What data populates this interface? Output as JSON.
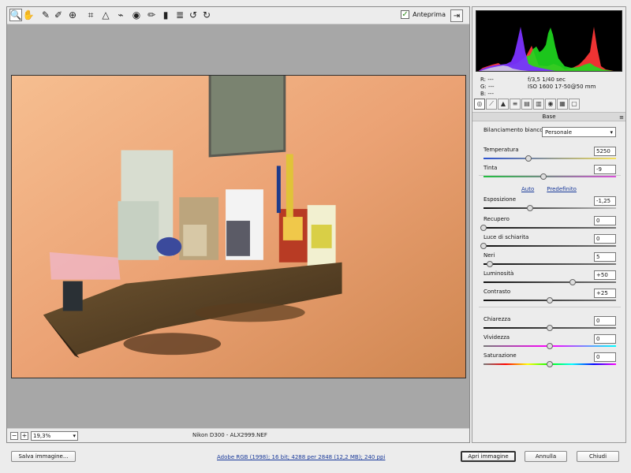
{
  "toolbar": {
    "tools": [
      {
        "name": "zoom-tool",
        "icon": "magnifier-icon",
        "glyph": "🔍"
      },
      {
        "name": "hand-tool",
        "icon": "hand-icon",
        "glyph": "✋"
      },
      {
        "name": "white-balance-tool",
        "icon": "eyedropper-icon",
        "glyph": "✎"
      },
      {
        "name": "color-sampler-tool",
        "icon": "eyedropper-plus-icon",
        "glyph": "✐"
      },
      {
        "name": "target-adjust-tool",
        "icon": "target-icon",
        "glyph": "⊕"
      },
      {
        "name": "crop-tool",
        "icon": "crop-icon",
        "glyph": "⌗"
      },
      {
        "name": "straighten-tool",
        "icon": "straighten-icon",
        "glyph": "△"
      },
      {
        "name": "spot-removal-tool",
        "icon": "brush-icon",
        "glyph": "⌁"
      },
      {
        "name": "red-eye-tool",
        "icon": "eye-icon",
        "glyph": "◉"
      },
      {
        "name": "adjustment-brush-tool",
        "icon": "paintbrush-icon",
        "glyph": "✏"
      },
      {
        "name": "graduated-filter-tool",
        "icon": "gradient-icon",
        "glyph": "▮"
      },
      {
        "name": "preferences-tool",
        "icon": "list-icon",
        "glyph": "≣"
      },
      {
        "name": "rotate-left-tool",
        "icon": "rotate-left-icon",
        "glyph": "↺"
      },
      {
        "name": "rotate-right-tool",
        "icon": "rotate-right-icon",
        "glyph": "↻"
      }
    ],
    "preview_label": "Anteprima",
    "preview_checked": true
  },
  "status": {
    "zoom_value": "19,3%",
    "file_info": "Nikon D300  -  ALX2999.NEF"
  },
  "readout": {
    "r": "R:   ---",
    "g": "G:   ---",
    "b": "B:   ---",
    "aperture": "f/3,5",
    "shutter": "1/40 sec",
    "iso": "ISO 1600",
    "lens": "17-50@50 mm"
  },
  "panel": {
    "title": "Base",
    "white_balance_label": "Bilanciamento bianco:",
    "white_balance_value": "Personale",
    "auto_link": "Auto",
    "default_link": "Predefinito",
    "sliders": [
      {
        "name": "temperature",
        "label": "Temperatura",
        "value": "5250",
        "position": 0.34
      },
      {
        "name": "tint",
        "label": "Tinta",
        "value": "-9",
        "position": 0.45
      },
      {
        "name": "exposure",
        "label": "Esposizione",
        "value": "-1,25",
        "position": 0.35
      },
      {
        "name": "recovery",
        "label": "Recupero",
        "value": "0",
        "position": 0.0
      },
      {
        "name": "fill-light",
        "label": "Luce di schiarita",
        "value": "0",
        "position": 0.0
      },
      {
        "name": "blacks",
        "label": "Neri",
        "value": "5",
        "position": 0.05
      },
      {
        "name": "brightness",
        "label": "Luminosità",
        "value": "+50",
        "position": 0.67
      },
      {
        "name": "contrast",
        "label": "Contrasto",
        "value": "+25",
        "position": 0.5
      },
      {
        "name": "clarity",
        "label": "Chiarezza",
        "value": "0",
        "position": 0.5
      },
      {
        "name": "vibrance",
        "label": "Vividezza",
        "value": "0",
        "position": 0.5
      },
      {
        "name": "saturation",
        "label": "Saturazione",
        "value": "0",
        "position": 0.5
      }
    ]
  },
  "bottom": {
    "save_button": "Salva immagine...",
    "workflow_link": "Adobe RGB (1998); 16 bit; 4288 per 2848 (12,2 MB); 240 ppi",
    "open_button": "Apri immagine",
    "cancel_button": "Annulla",
    "close_button": "Chiudi"
  }
}
